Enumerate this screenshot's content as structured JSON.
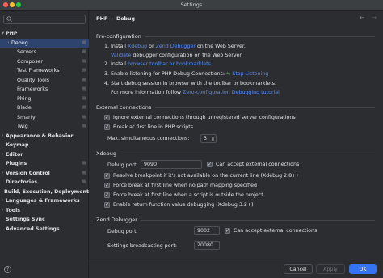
{
  "window": {
    "title": "Settings"
  },
  "colors": {
    "close": "#ff5f57",
    "minimize": "#febc2e",
    "maximize": "#28c840",
    "accent": "#3574f0",
    "link": "#548af7"
  },
  "search": {
    "placeholder": "",
    "icon": "search-icon"
  },
  "sidebar": {
    "php": "PHP",
    "php_children": [
      "Debug",
      "Servers",
      "Composer",
      "Test Frameworks",
      "Quality Tools",
      "Frameworks",
      "Phing",
      "Blade",
      "Smarty",
      "Twig"
    ],
    "after": [
      "Appearance & Behavior",
      "Keymap",
      "Editor",
      "Plugins",
      "Version Control",
      "Directories",
      "Build, Execution, Deployment",
      "Languages & Frameworks",
      "Tools",
      "Settings Sync",
      "Advanced Settings"
    ]
  },
  "breadcrumb": {
    "parent": "PHP",
    "sep": "›",
    "current": "Debug"
  },
  "preconfig": {
    "title": "Pre-configuration",
    "s1_a": "1. Install ",
    "s1_xdebug": "Xdebug",
    "s1_or": " or ",
    "s1_zend": "Zend Debugger",
    "s1_b": " on the Web Server.",
    "s1_validate": "Validate",
    "s1_c": " debugger configuration on the Web Server.",
    "s2_a": "2. Install ",
    "s2_link": "browser toolbar or bookmarklets",
    "s2_b": ".",
    "s3_a": "3. Enable listening for PHP Debug Connections: ",
    "s3_link": "Stop Listening",
    "s4_a": "4. Start debug session in browser with the toolbar or bookmarklets.",
    "s4_b": "For more information follow ",
    "s4_link": "Zero-configuration Debugging tutorial"
  },
  "external": {
    "title": "External connections",
    "ignore": "Ignore external connections through unregistered server configurations",
    "break_first": "Break at first line in PHP scripts",
    "max_label": "Max. simultaneous connections:",
    "max_value": "3"
  },
  "xdebug": {
    "title": "Xdebug",
    "port_label": "Debug port:",
    "port_value": "9090",
    "accept": "Can accept external connections",
    "resolve": "Resolve breakpoint if it's not available on the current line (Xdebug 2.8+)",
    "force_no_mapping": "Force break at first line when no path mapping specified",
    "force_outside": "Force break at first line when a script is outside the project",
    "return_value": "Enable return function value debugging (Xdebug 3.2+)"
  },
  "zend": {
    "title": "Zend Debugger",
    "port_label": "Debug port:",
    "port_value": "9002",
    "accept": "Can accept external connections",
    "broadcast_label": "Settings broadcasting port:",
    "broadcast_value": "20080"
  },
  "footer": {
    "help": "?",
    "cancel": "Cancel",
    "apply": "Apply",
    "ok": "OK"
  }
}
